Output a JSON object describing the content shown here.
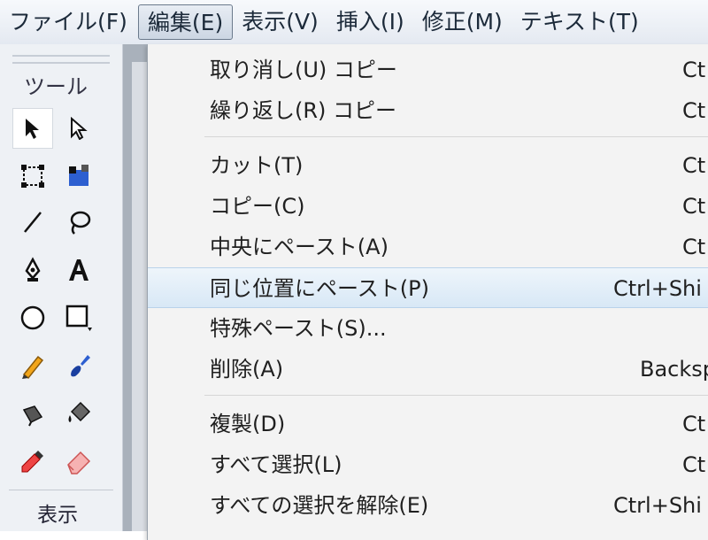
{
  "menubar": {
    "items": [
      "ファイル(F)",
      "編集(E)",
      "表示(V)",
      "挿入(I)",
      "修正(M)",
      "テキスト(T)"
    ],
    "active": "編集(E)"
  },
  "tools": {
    "title": "ツール",
    "footer": "表示"
  },
  "edit_menu": {
    "items": [
      {
        "label": "取り消し(U) コピー",
        "shortcut": "Ct"
      },
      {
        "label": "繰り返し(R) コピー",
        "shortcut": "Ct"
      },
      {
        "label": "カット(T)",
        "shortcut": "Ct"
      },
      {
        "label": "コピー(C)",
        "shortcut": "Ct"
      },
      {
        "label": "中央にペースト(A)",
        "shortcut": "Ct"
      },
      {
        "label": "同じ位置にペースト(P)",
        "shortcut": "Ctrl+Shi"
      },
      {
        "label": "特殊ペースト(S)...",
        "shortcut": ""
      },
      {
        "label": "削除(A)",
        "shortcut": "Backsp"
      },
      {
        "label": "複製(D)",
        "shortcut": "Ct"
      },
      {
        "label": "すべて選択(L)",
        "shortcut": "Ct"
      },
      {
        "label": "すべての選択を解除(E)",
        "shortcut": "Ctrl+Shi"
      }
    ],
    "highlighted": "同じ位置にペースト(P)"
  }
}
